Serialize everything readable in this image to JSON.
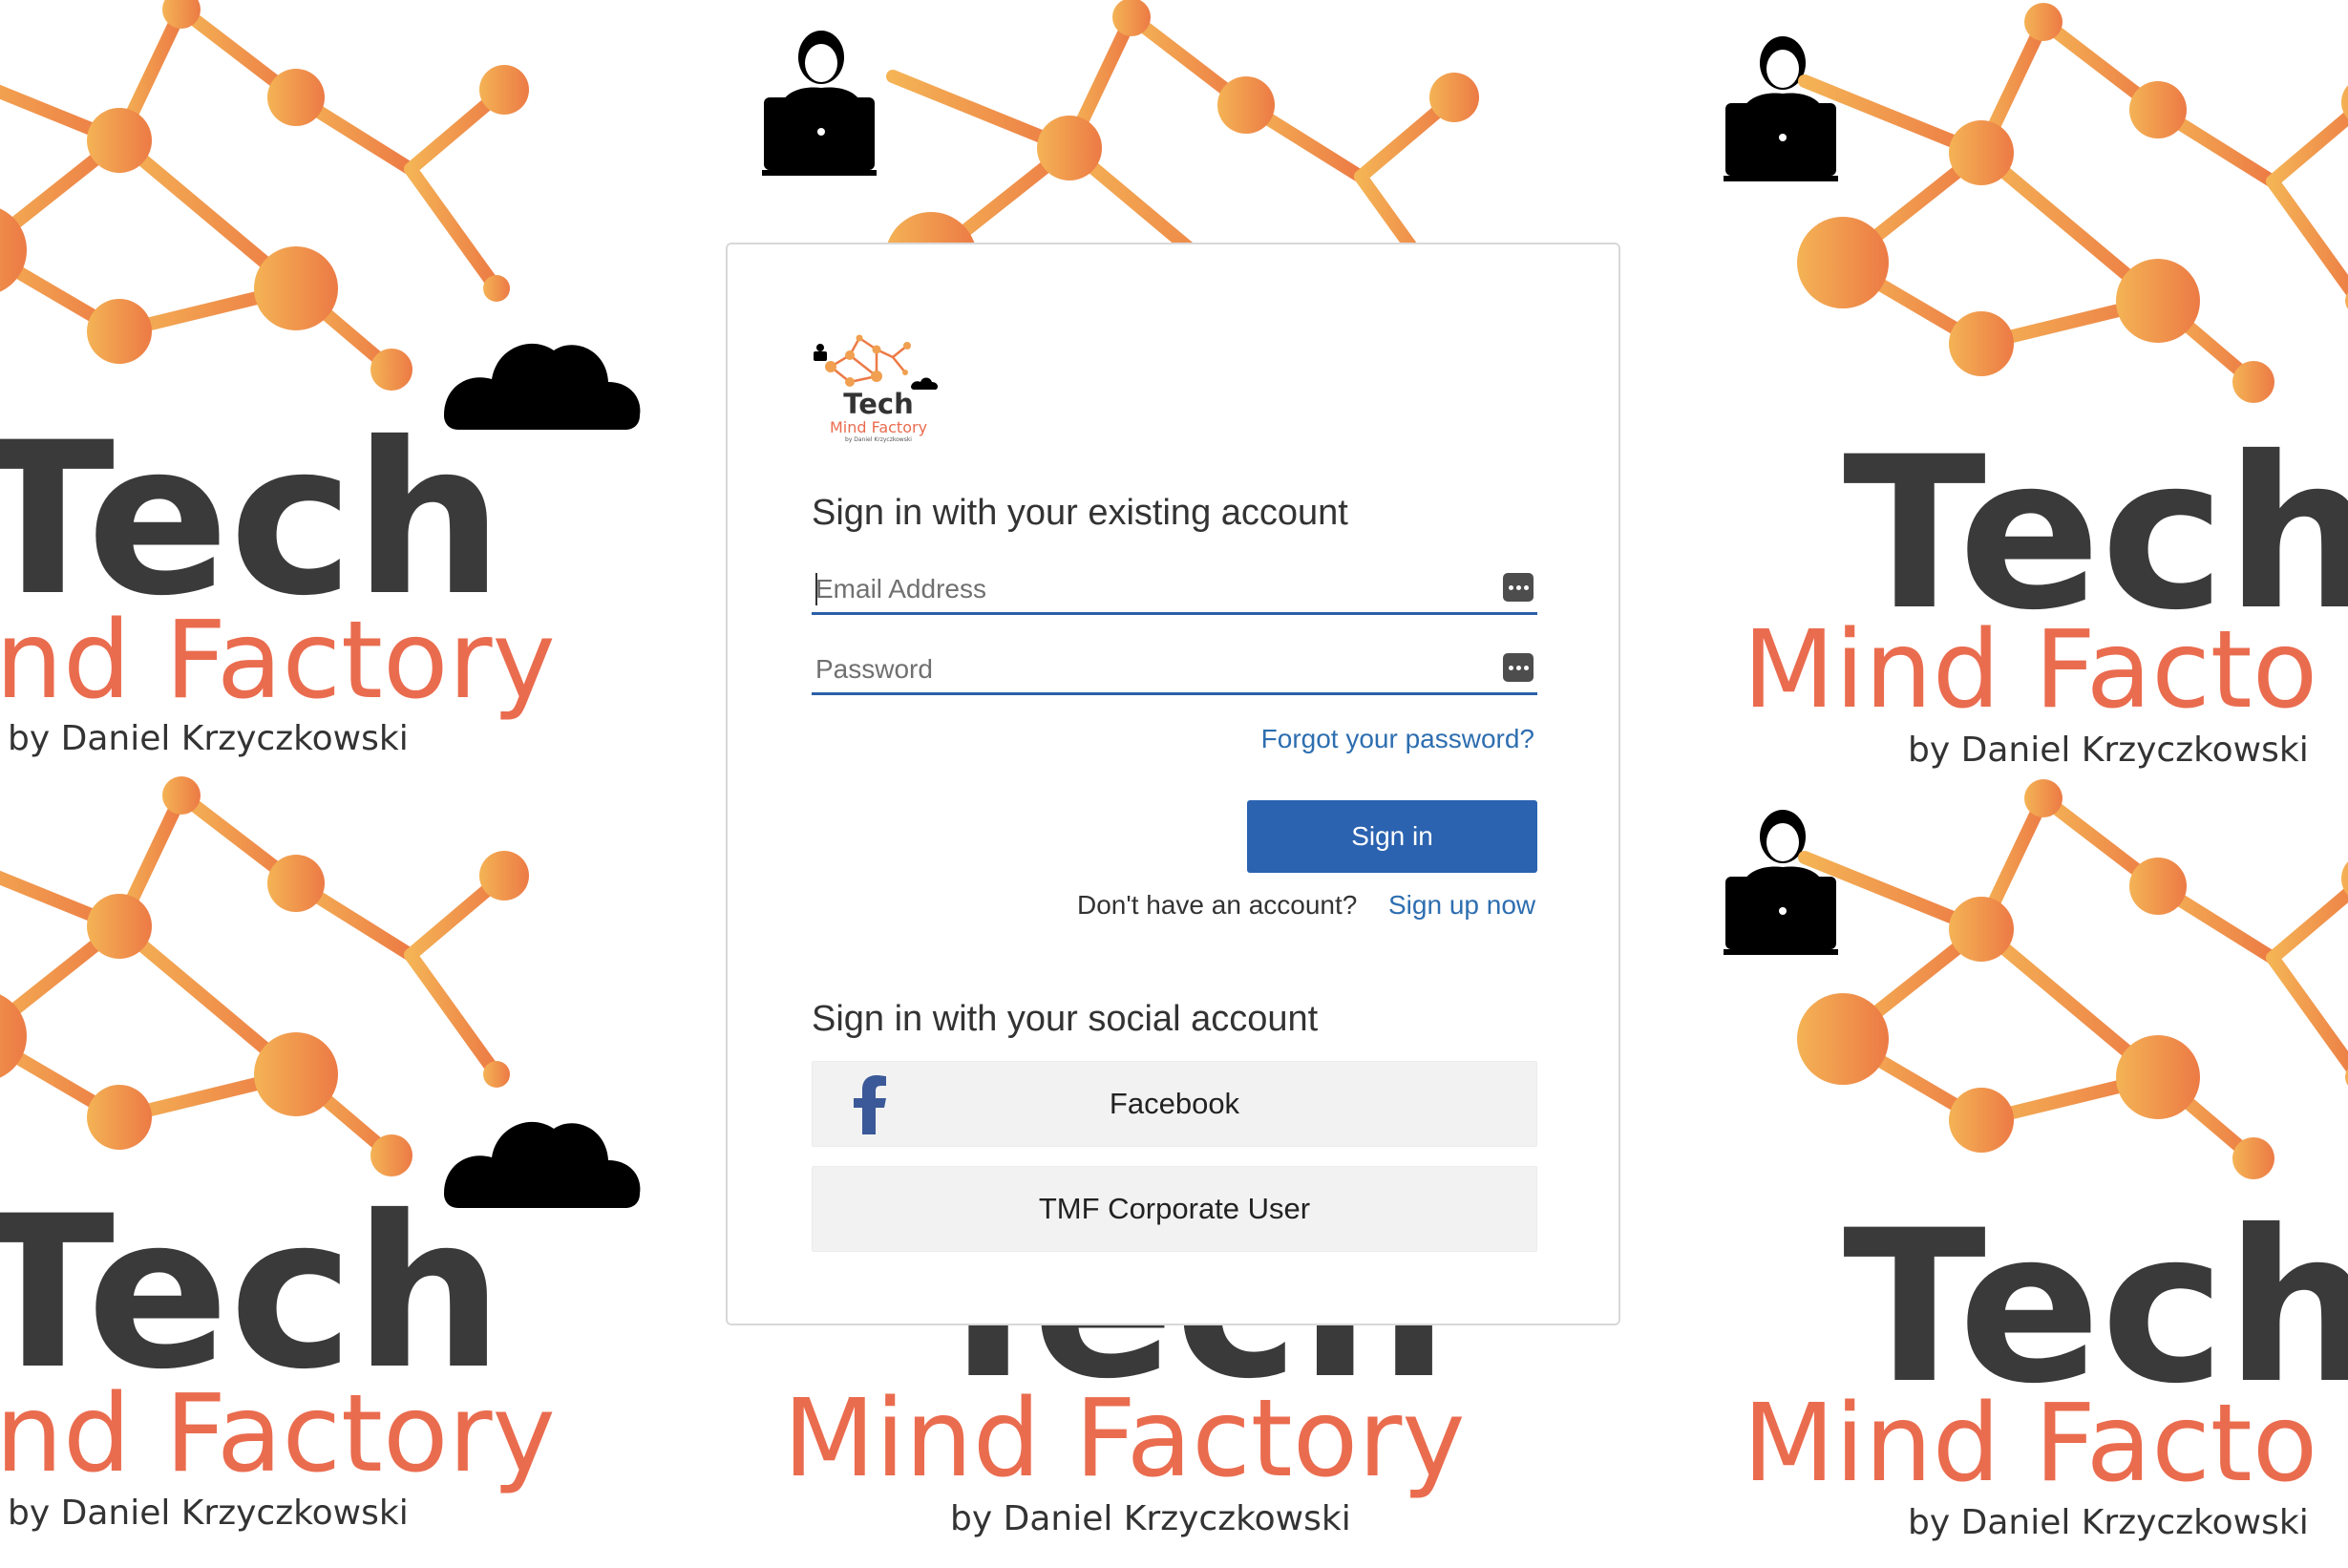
{
  "background": {
    "brand_tech": "Tech",
    "brand_mind_factory": "Mind Factory",
    "brand_by": "by Daniel Krzyczkowski",
    "left_column_mind": "nd Factory",
    "right_column_mind": "Mind Facto",
    "colors": {
      "tech_text": "#3a3a3a",
      "mind_text": "#ea6c4f",
      "node_light": "#f4b355",
      "node_dark": "#ec7a45"
    }
  },
  "logo": {
    "tech": "Tech",
    "mind_factory": "Mind Factory",
    "by": "by Daniel Krzyczkowski"
  },
  "local_signin": {
    "heading": "Sign in with your existing account",
    "email_placeholder": "Email Address",
    "password_placeholder": "Password",
    "forgot_password": "Forgot your password?",
    "signin_button": "Sign in",
    "no_account_text": "Don't have an account?",
    "signup_link": "Sign up now"
  },
  "social_signin": {
    "heading": "Sign in with your social account",
    "providers": [
      {
        "label": "Facebook",
        "icon": "facebook-icon"
      },
      {
        "label": "TMF Corporate User",
        "icon": ""
      }
    ]
  },
  "colors": {
    "primary_button": "#2b63b1",
    "link": "#2d6eb0",
    "input_underline": "#2b5fa8",
    "facebook_blue": "#3b5998"
  }
}
